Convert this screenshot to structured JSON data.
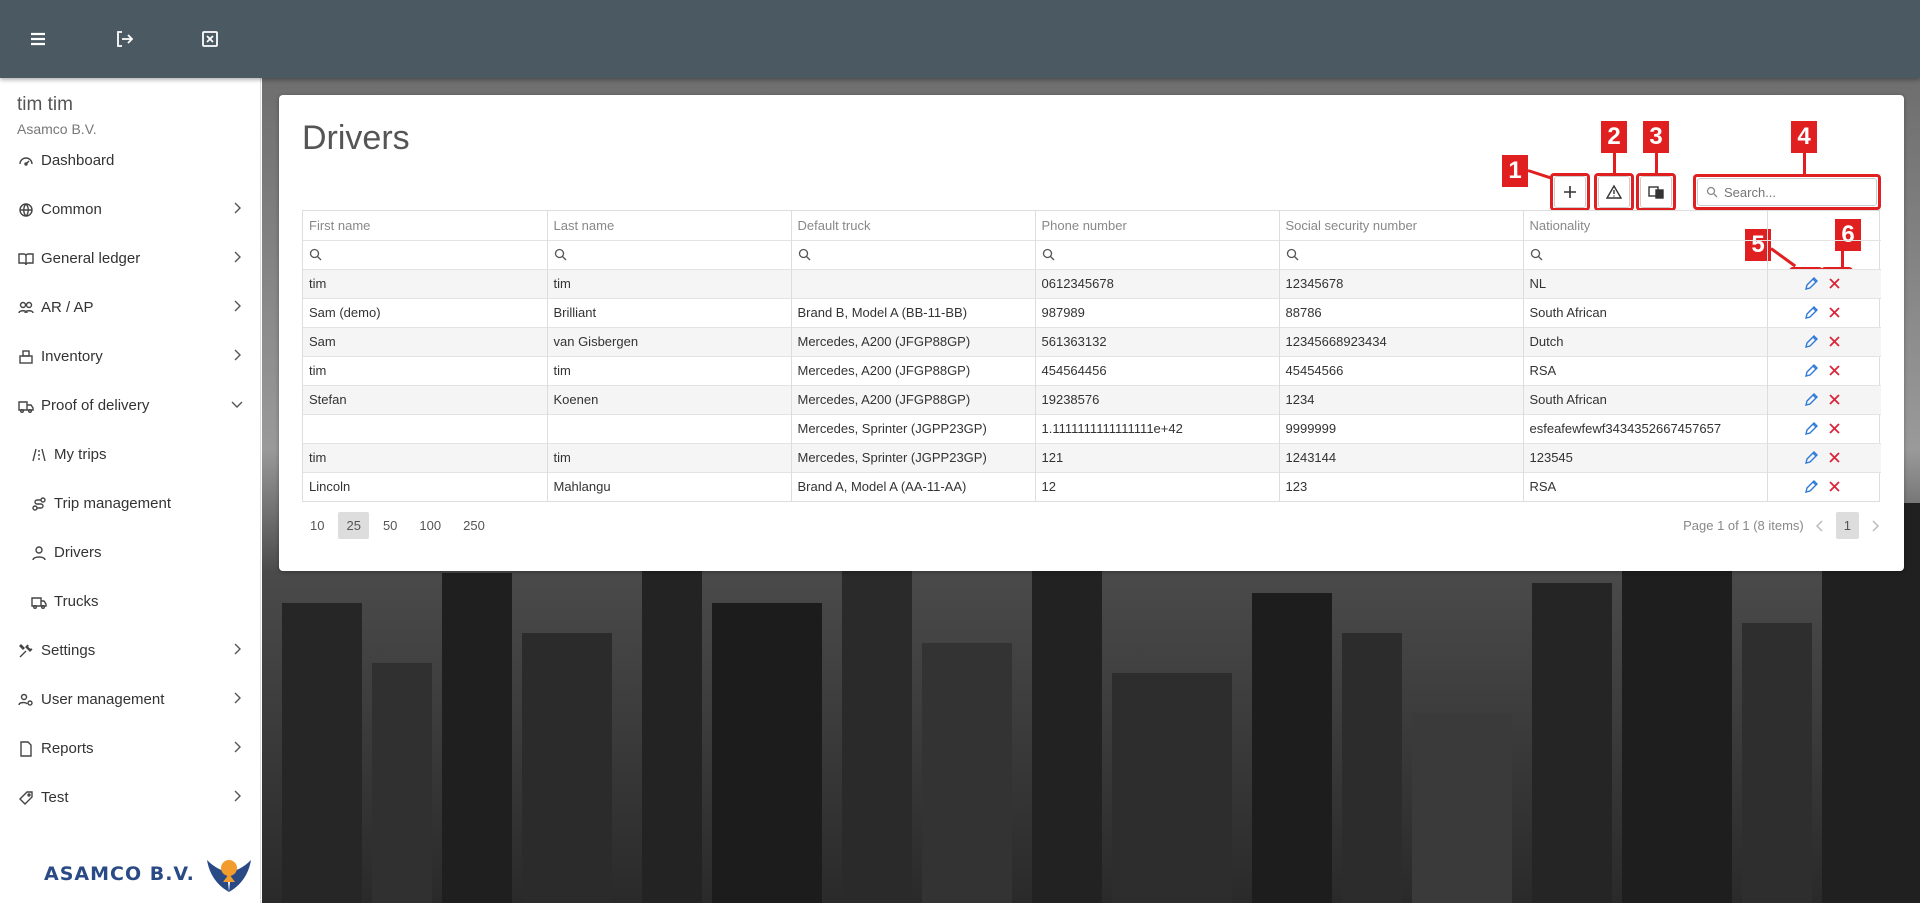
{
  "topbar": {
    "icons": [
      "menu-icon",
      "logout-icon",
      "close-window-icon"
    ]
  },
  "sidebar": {
    "user_name": "tim tim",
    "company": "Asamco B.V.",
    "items": [
      {
        "label": "Dashboard",
        "icon": "dashboard-icon"
      },
      {
        "label": "Common",
        "icon": "globe-icon"
      },
      {
        "label": "General ledger",
        "icon": "book-icon"
      },
      {
        "label": "AR / AP",
        "icon": "users-icon"
      },
      {
        "label": "Inventory",
        "icon": "inventory-icon"
      },
      {
        "label": "Proof of delivery",
        "icon": "delivery-icon"
      },
      {
        "label": "My trips",
        "icon": "road-icon"
      },
      {
        "label": "Trip management",
        "icon": "route-icon"
      },
      {
        "label": "Drivers",
        "icon": "user-icon"
      },
      {
        "label": "Trucks",
        "icon": "truck-icon"
      },
      {
        "label": "Settings",
        "icon": "tools-icon"
      },
      {
        "label": "User management",
        "icon": "user-cog-icon"
      },
      {
        "label": "Reports",
        "icon": "file-icon"
      },
      {
        "label": "Test",
        "icon": "tag-icon"
      }
    ],
    "logo_text": "ASAMCO B.V."
  },
  "main": {
    "title": "Drivers",
    "search_placeholder": "Search...",
    "annotations": [
      "1",
      "2",
      "3",
      "4",
      "5",
      "6"
    ],
    "columns": [
      "First name",
      "Last name",
      "Default truck",
      "Phone number",
      "Social security number",
      "Nationality"
    ],
    "rows": [
      [
        "tim",
        "tim",
        "",
        "0612345678",
        "12345678",
        "NL"
      ],
      [
        "Sam (demo)",
        "Brilliant",
        "Brand B, Model A (BB-11-BB)",
        "987989",
        "88786",
        "South African"
      ],
      [
        "Sam",
        "van Gisbergen",
        "Mercedes, A200 (JFGP88GP)",
        "561363132",
        "12345668923434",
        "Dutch"
      ],
      [
        "tim",
        "tim",
        "Mercedes, A200 (JFGP88GP)",
        "454564456",
        "45454566",
        "RSA"
      ],
      [
        "Stefan",
        "Koenen",
        "Mercedes, A200 (JFGP88GP)",
        "19238576",
        "1234",
        "South African"
      ],
      [
        "",
        "",
        "Mercedes, Sprinter (JGPP23GP)",
        "1.1111111111111111e+42",
        "9999999",
        "esfeafewfewf3434352667457657"
      ],
      [
        "tim",
        "tim",
        "Mercedes, Sprinter (JGPP23GP)",
        "121",
        "1243144",
        "123545"
      ],
      [
        "Lincoln",
        "Mahlangu",
        "Brand A, Model A (AA-11-AA)",
        "12",
        "123",
        "RSA"
      ]
    ],
    "page_sizes": [
      "10",
      "25",
      "50",
      "100",
      "250"
    ],
    "page_size_selected": "25",
    "page_info": "Page 1 of 1 (8 items)",
    "current_page": "1"
  }
}
